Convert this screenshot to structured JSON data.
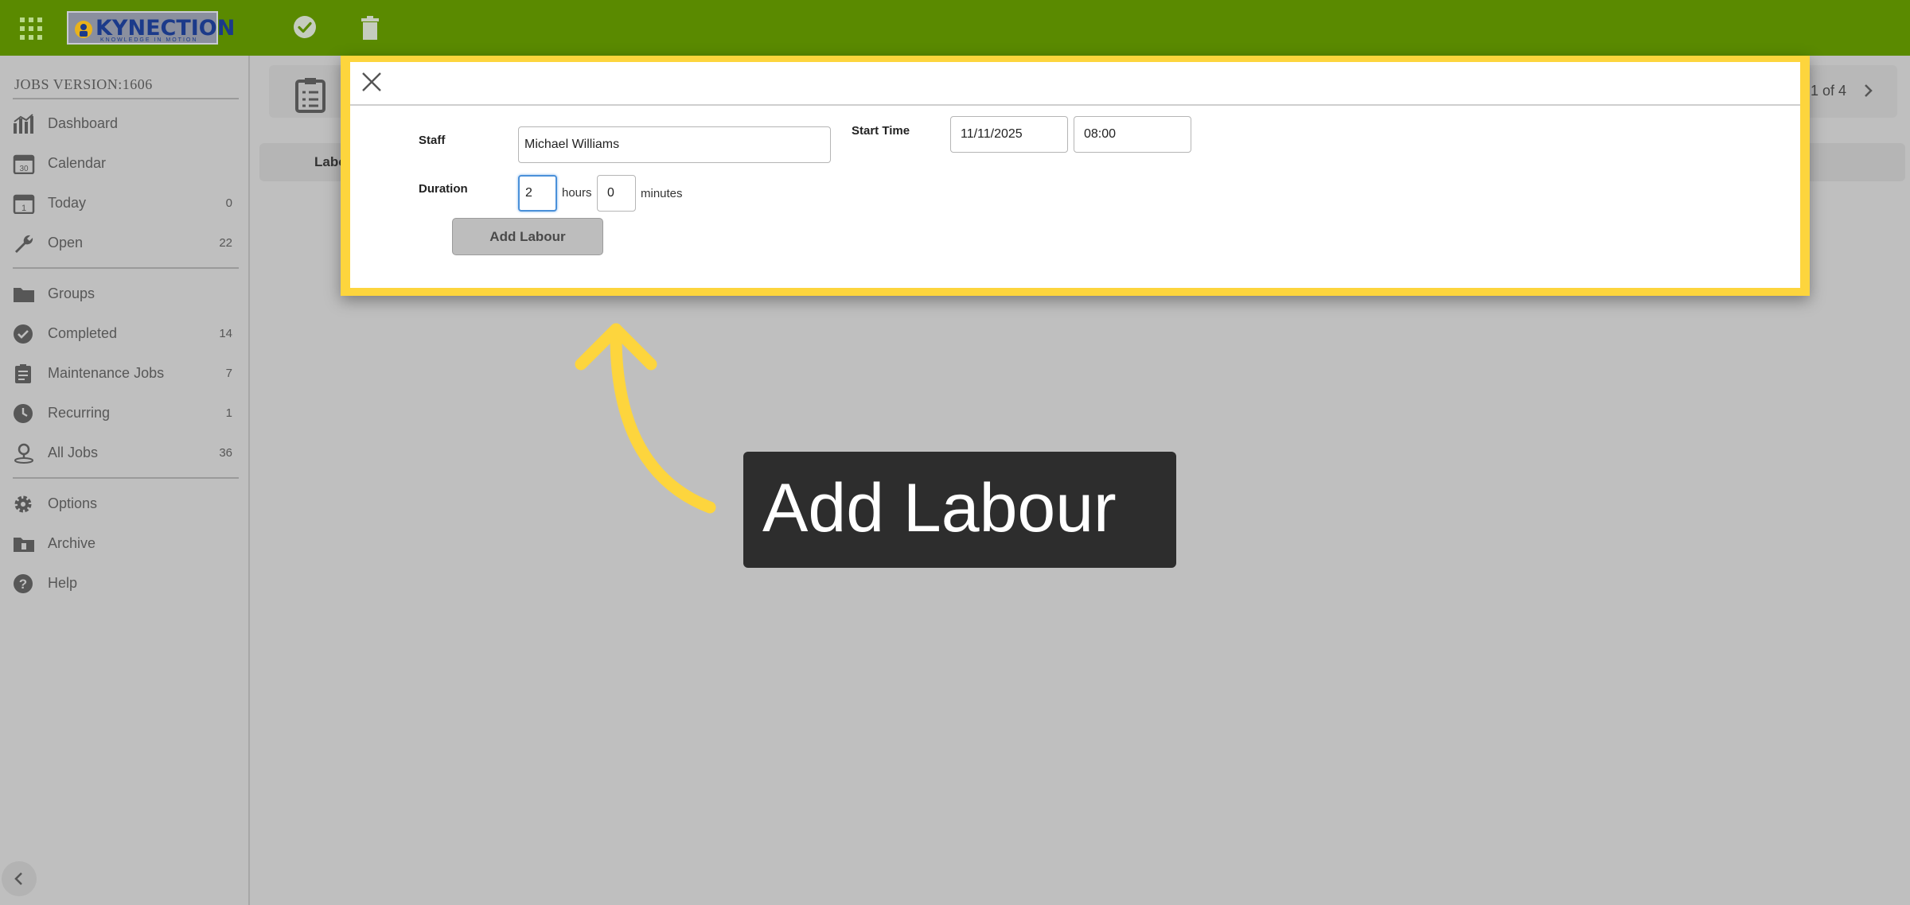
{
  "topbar": {
    "logo_text": "KYNECTION",
    "logo_tagline": "KNOWLEDGE IN MOTION",
    "icons": [
      "apps-grid-icon",
      "check-circle-icon",
      "trash-icon"
    ],
    "bg_color": "#5a8a00"
  },
  "sidebar": {
    "version": "JOBS VERSION:1606",
    "items": [
      {
        "label": "Dashboard",
        "count": "",
        "icon": "chart-icon"
      },
      {
        "label": "Calendar",
        "count": "",
        "icon": "calendar-icon"
      },
      {
        "label": "Today",
        "count": "0",
        "icon": "today-icon"
      },
      {
        "label": "Open",
        "count": "22",
        "icon": "wrench-icon"
      },
      {
        "label": "Groups",
        "count": "",
        "icon": "folder-icon"
      },
      {
        "label": "Completed",
        "count": "14",
        "icon": "check-circle-icon"
      },
      {
        "label": "Maintenance Jobs",
        "count": "7",
        "icon": "clipboard-list-icon"
      },
      {
        "label": "Recurring",
        "count": "1",
        "icon": "clock-icon"
      },
      {
        "label": "All Jobs",
        "count": "36",
        "icon": "map-pin-user-icon"
      },
      {
        "label": "Options",
        "count": "",
        "icon": "gear-icon"
      },
      {
        "label": "Archive",
        "count": "",
        "icon": "archive-icon"
      },
      {
        "label": "Help",
        "count": "",
        "icon": "help-icon"
      }
    ]
  },
  "background": {
    "pager": "1 of 4",
    "tab_label": "Labo"
  },
  "modal": {
    "staff_label": "Staff",
    "staff_value": "Michael Williams",
    "start_time_label": "Start Time",
    "start_date_value": "11/11/2025",
    "start_time_value": "08:00",
    "duration_label": "Duration",
    "hours_value": "2",
    "hours_unit": "hours",
    "minutes_value": "0",
    "minutes_unit": "minutes",
    "add_button_label": "Add Labour",
    "frame_color": "#fdd53d"
  },
  "annotation": {
    "callout_text": "Add Labour",
    "arrow_color": "#fdd53d"
  }
}
